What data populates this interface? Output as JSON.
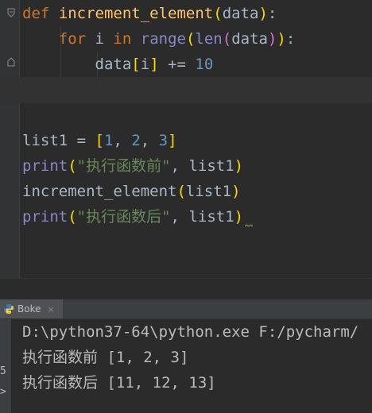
{
  "editor": {
    "line1": {
      "kw": "def",
      "name": "increment_element",
      "open": "(",
      "param": "data",
      "close": ")",
      "colon": ":"
    },
    "line2": {
      "indent": "    ",
      "kw_for": "for",
      "var": " i ",
      "kw_in": "in",
      "sp": " ",
      "range": "range",
      "open1": "(",
      "len": "len",
      "open2": "(",
      "arg": "data",
      "close2": ")",
      "close1": ")",
      "colon": ":"
    },
    "line3": {
      "indent": "        ",
      "text1": "data",
      "lb": "[",
      "idx": "i",
      "rb": "]",
      "op": " += ",
      "num": "10"
    },
    "line5": {
      "name": "list1 = ",
      "lb": "[",
      "n1": "1",
      "c1": ", ",
      "n2": "2",
      "c2": ", ",
      "n3": "3",
      "rb": "]"
    },
    "line6": {
      "fn": "print",
      "open": "(",
      "str": "\"执行函数前\"",
      "comma": ", ",
      "arg": "list1",
      "close": ")"
    },
    "line7": {
      "fn": "increment_element",
      "open": "(",
      "arg": "list1",
      "close": ")"
    },
    "line8": {
      "fn": "print",
      "open": "(",
      "str": "\"执行函数后\"",
      "comma": ", ",
      "arg": "list1",
      "close": ")"
    }
  },
  "run_panel": {
    "tab_label": "Boke",
    "close_glyph": "×",
    "side_marker": "5",
    "side_marker2": ">"
  },
  "console": {
    "line1": "D:\\python37-64\\python.exe F:/pycharm/",
    "line2_cn": "执行函数前",
    "line2_val": " [1, 2, 3]",
    "line3_cn": "执行函数后",
    "line3_val": " [11, 12, 13]"
  },
  "icons": {
    "fold": "fold-marker-icon",
    "python": "python-icon"
  }
}
